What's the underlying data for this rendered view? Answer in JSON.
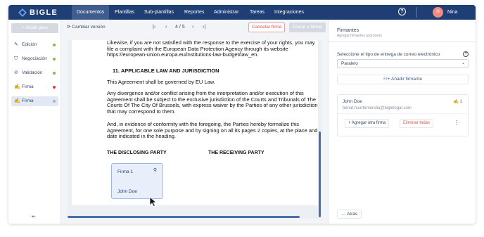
{
  "nav": {
    "brand": "BIGLE",
    "items": [
      "Documentos",
      "Plantillas",
      "Sub-plantillas",
      "Reportes",
      "Administrar",
      "Tareas",
      "Integraciones"
    ],
    "active_index": 0,
    "help": "?",
    "avatar_initial": "N",
    "user": "Nina",
    "bg_color": "#1e3e74"
  },
  "sidebar": {
    "add_step": "+ Añadir paso",
    "items": [
      {
        "label": "Edición",
        "icon": "edit-icon",
        "status_color": "#7bc043"
      },
      {
        "label": "Negociación",
        "icon": "handshake-icon",
        "status_color": "#7bc043"
      },
      {
        "label": "Validación",
        "icon": "check-circle-icon",
        "status_color": "#7bc043"
      },
      {
        "label": "Firma",
        "icon": "signature-icon",
        "status_color": "#e53935"
      },
      {
        "label": "Firma",
        "icon": "signature-icon",
        "status_color": "#a5b1c2"
      }
    ],
    "active_index": 4
  },
  "toolbar": {
    "change_version": "Cambiar versión",
    "page_current": "4",
    "page_total": "5",
    "page_indicator": "4 / 5",
    "cancel_signature": "Cancelar firma",
    "send_to_sign": "Enviar a firmar"
  },
  "document": {
    "p1": "Likewise, if you are not satisfied with the response to the exercise of your rights, you may file a complaint with the European Data Protection Agency through its website https://european-union.europa.eu/institutions-law-budget/law_en.",
    "heading": "11. APPLICABLE LAW AND JURISDICTION",
    "p2": "This Agreement shall be governed by EU Law.",
    "p3": "Any divergence and/or conflict arising from the interpretation and/or execution of this Agreement shall be subject to the exclusive jurisdiction of the Courts and Tribunals of The Courts Of The City Of Brussels, with express waiver by the Parties of any other jurisdiction that may correspond to them.",
    "p4": "And, in evidence of conformity with the foregoing, the Parties hereby formalize this Agreement, for one sole purpose and by signing on all its pages 2 copies, at the place and date indicated in the heading.",
    "party_left": "THE DISCLOSING PARTY",
    "party_right": "THE RECEIVING PARTY",
    "signature_box": {
      "label": "Firma 1",
      "name": "John Doe"
    }
  },
  "panel": {
    "title": "Firmantes",
    "subtitle": "Agregar firmantes al proceso",
    "delivery_question": "Seleccione el tipo de entrega de correo electrónico",
    "delivery_value": "Paralelo",
    "add_signer": "Añadir firmante",
    "signer": {
      "name": "John Doe",
      "email": "benat.huartemendia@biglelegal.com",
      "count": "1",
      "add_signature": "+ Agregar otra firma",
      "delete_all": "Eliminar todas"
    },
    "back": "Atrás"
  }
}
